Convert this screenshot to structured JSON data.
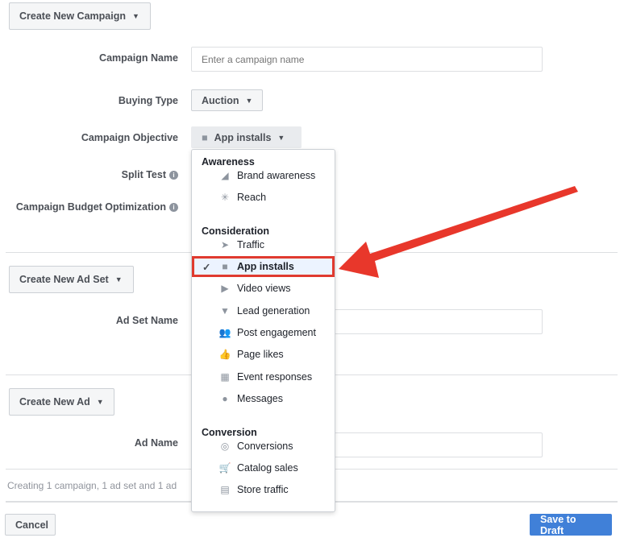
{
  "campaign": {
    "button": "Create New Campaign",
    "name_label": "Campaign Name",
    "name_placeholder": "Enter a campaign name",
    "buying_label": "Buying Type",
    "buying_value": "Auction",
    "objective_label": "Campaign Objective",
    "objective_value": "App installs",
    "split_label": "Split Test",
    "cbo_label": "Campaign Budget Optimization"
  },
  "adset": {
    "button": "Create New Ad Set",
    "name_label": "Ad Set Name"
  },
  "ad": {
    "button": "Create New Ad",
    "name_label": "Ad Name"
  },
  "summary": "Creating 1 campaign, 1 ad set and 1 ad",
  "footer": {
    "cancel": "Cancel",
    "save": "Save to Draft"
  },
  "menu": {
    "groups": [
      {
        "title": "Awareness",
        "items": [
          {
            "label": "Brand awareness",
            "icon": "megaphone-icon"
          },
          {
            "label": "Reach",
            "icon": "reach-icon"
          }
        ]
      },
      {
        "title": "Consideration",
        "items": [
          {
            "label": "Traffic",
            "icon": "cursor-icon"
          },
          {
            "label": "App installs",
            "icon": "box-icon",
            "selected": true
          },
          {
            "label": "Video views",
            "icon": "video-icon"
          },
          {
            "label": "Lead generation",
            "icon": "funnel-icon"
          },
          {
            "label": "Post engagement",
            "icon": "people-icon"
          },
          {
            "label": "Page likes",
            "icon": "thumbs-up-icon"
          },
          {
            "label": "Event responses",
            "icon": "calendar-icon"
          },
          {
            "label": "Messages",
            "icon": "chat-icon"
          }
        ]
      },
      {
        "title": "Conversion",
        "items": [
          {
            "label": "Conversions",
            "icon": "globe-icon"
          },
          {
            "label": "Catalog sales",
            "icon": "cart-icon"
          },
          {
            "label": "Store traffic",
            "icon": "store-icon"
          }
        ]
      }
    ]
  },
  "colors": {
    "highlight": "#e03a2f",
    "primary": "#4080d8"
  }
}
